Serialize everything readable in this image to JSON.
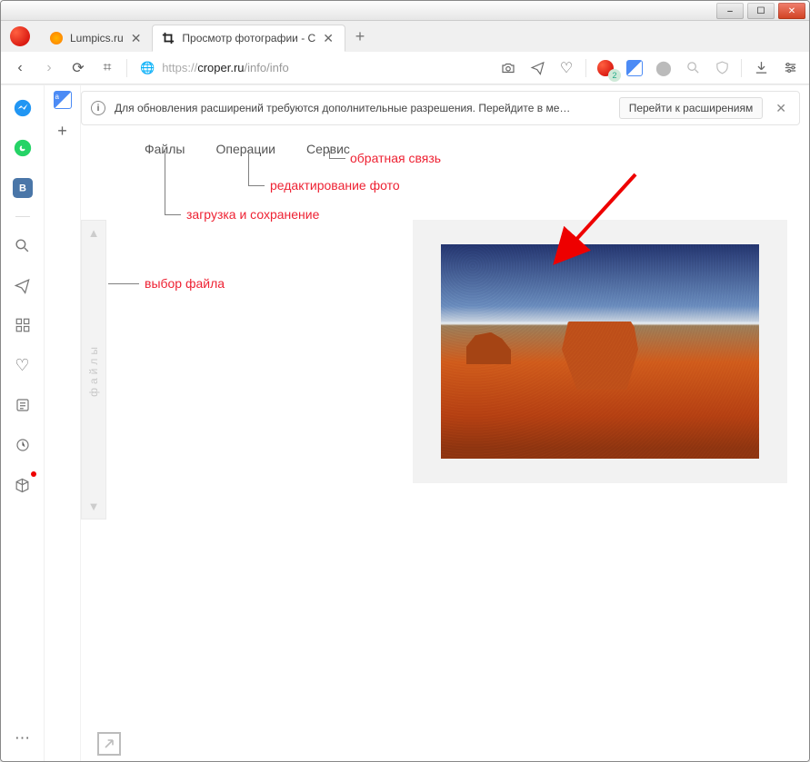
{
  "window": {
    "min_label": "–",
    "max_label": "☐",
    "close_label": "✕"
  },
  "tabs": [
    {
      "title": "Lumpics.ru",
      "active": false,
      "favicon": "lumpics"
    },
    {
      "title": "Просмотр фотографии - C",
      "active": true,
      "favicon": "crop"
    }
  ],
  "new_tab_label": "+",
  "toolbar": {
    "back": "‹",
    "forward": "›",
    "reload": "⟳",
    "speed_dial": "⌗",
    "globe": "🌐",
    "url_protocol": "https://",
    "url_host": "croper.ru",
    "url_path": "/info/info",
    "snapshot": "⎘",
    "send": "➤",
    "heart": "♡",
    "opera_badge": "O",
    "translate_badge": "a",
    "ext1": "⬤",
    "search_ext": "🔍",
    "adblock": "🛡",
    "sep": "|",
    "download": "⭳",
    "menu": "≡"
  },
  "left_rail": {
    "messenger": "messenger",
    "whatsapp": "whatsapp",
    "vk": "vk",
    "search": "🔍",
    "send": "➤",
    "apps": "⌗",
    "heart": "♡",
    "news": "🖹",
    "history": "🕘",
    "cube": "⬚",
    "more": "⋯"
  },
  "second_rail": {
    "translate": "aあ",
    "add": "+"
  },
  "infobar": {
    "icon": "i",
    "message": "Для обновления расширений требуются дополнительные разрешения. Перейдите в ме…",
    "button": "Перейти к расширениям",
    "dismiss": "✕"
  },
  "page_menu": {
    "files": "Файлы",
    "operations": "Операции",
    "service": "Сервис"
  },
  "annotations": {
    "feedback": "обратная связь",
    "photo_edit": "редактирование фото",
    "upload_save": "загрузка и сохранение",
    "file_select": "выбор файла"
  },
  "files_panel": {
    "label": "файлы",
    "up": "▲",
    "down": "▼"
  },
  "expand_icon": "↗"
}
